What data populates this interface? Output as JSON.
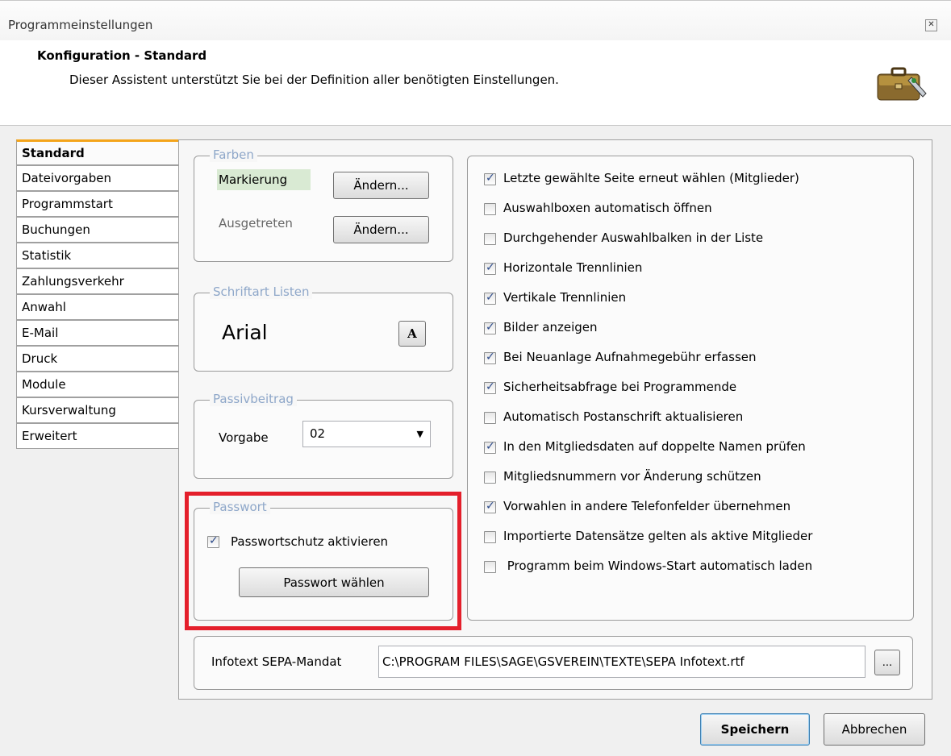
{
  "window": {
    "title": "Programmeinstellungen"
  },
  "header": {
    "title": "Konfiguration - Standard",
    "subtitle": "Dieser Assistent unterstützt Sie bei der Definition aller benötigten Einstellungen."
  },
  "tabs": [
    {
      "label": "Standard",
      "active": true
    },
    {
      "label": "Dateivorgaben"
    },
    {
      "label": "Programmstart"
    },
    {
      "label": "Buchungen"
    },
    {
      "label": "Statistik"
    },
    {
      "label": "Zahlungsverkehr"
    },
    {
      "label": "Anwahl"
    },
    {
      "label": "E-Mail"
    },
    {
      "label": "Druck"
    },
    {
      "label": "Module"
    },
    {
      "label": "Kursverwaltung"
    },
    {
      "label": "Erweitert"
    }
  ],
  "farben": {
    "legend": "Farben",
    "markierung": "Markierung",
    "ausgetreten": "Ausgetreten",
    "change_label": "Ändern...",
    "markierung_color": "#d9ead3"
  },
  "schriftart": {
    "legend": "Schriftart Listen",
    "font_name": "Arial",
    "button_glyph": "A"
  },
  "passivbeitrag": {
    "legend": "Passivbeitrag",
    "label": "Vorgabe",
    "value": "02"
  },
  "passwort": {
    "legend": "Passwort",
    "checkbox_label": "Passwortschutz aktivieren",
    "checked": true,
    "button_label": "Passwort wählen"
  },
  "options": [
    {
      "label": "Letzte gewählte Seite erneut wählen (Mitglieder)",
      "checked": true
    },
    {
      "label": "Auswahlboxen automatisch öffnen",
      "checked": false
    },
    {
      "label": "Durchgehender Auswahlbalken in der Liste",
      "checked": false
    },
    {
      "label": "Horizontale Trennlinien",
      "checked": true
    },
    {
      "label": "Vertikale Trennlinien",
      "checked": true
    },
    {
      "label": "Bilder anzeigen",
      "checked": true
    },
    {
      "label": "Bei Neuanlage Aufnahmegebühr erfassen",
      "checked": true
    },
    {
      "label": "Sicherheitsabfrage bei Programmende",
      "checked": true
    },
    {
      "label": "Automatisch Postanschrift aktualisieren",
      "checked": false
    },
    {
      "label": "In den Mitgliedsdaten auf doppelte Namen prüfen",
      "checked": true
    },
    {
      "label": "Mitgliedsnummern vor Änderung schützen",
      "checked": false
    },
    {
      "label": "Vorwahlen in andere Telefonfelder übernehmen",
      "checked": true
    },
    {
      "label": "Importierte Datensätze gelten als aktive Mitglieder",
      "checked": false
    },
    {
      "label": " Programm beim Windows-Start automatisch laden",
      "checked": false
    }
  ],
  "infotext": {
    "label": "Infotext SEPA-Mandat",
    "path": "C:\\PROGRAM FILES\\SAGE\\GSVEREIN\\TEXTE\\SEPA Infotext.rtf",
    "browse_label": "..."
  },
  "footer": {
    "save_label": "Speichern",
    "cancel_label": "Abbrechen"
  },
  "colors": {
    "highlight": "#e41f2b",
    "tab_accent": "#f4a41a",
    "check": "#2c4a8a"
  }
}
